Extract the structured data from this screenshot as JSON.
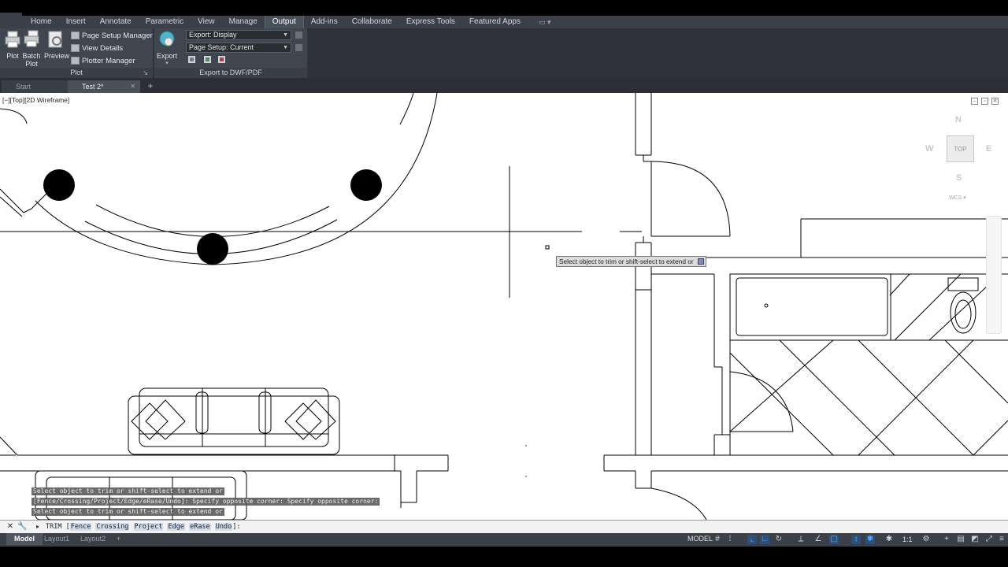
{
  "ribbon": {
    "tabs": [
      {
        "label": "Home"
      },
      {
        "label": "Insert"
      },
      {
        "label": "Annotate"
      },
      {
        "label": "Parametric"
      },
      {
        "label": "View"
      },
      {
        "label": "Manage"
      },
      {
        "label": "Output"
      },
      {
        "label": "Add-ins"
      },
      {
        "label": "Collaborate"
      },
      {
        "label": "Express Tools"
      },
      {
        "label": "Featured Apps"
      }
    ],
    "active_tab": "Output",
    "plot_panel": {
      "title": "Plot",
      "plot_label": "Plot",
      "batch_plot_label": "Batch Plot",
      "preview_label": "Preview",
      "page_setup_manager": "Page Setup Manager",
      "view_details": "View Details",
      "plotter_manager": "Plotter Manager"
    },
    "export_panel": {
      "title": "Export to DWF/PDF",
      "export_label": "Export",
      "export_dropdown": "Export: Display",
      "page_setup_dropdown": "Page Setup: Current"
    }
  },
  "doc_tabs": {
    "start": "Start",
    "current": "Test 2*"
  },
  "viewport": {
    "label": "[−][Top][2D Wireframe]",
    "viewcube": {
      "n": "N",
      "s": "S",
      "e": "E",
      "w": "W",
      "top": "TOP",
      "wcs": "WCS"
    }
  },
  "tooltip": "Select object to trim or shift-select to extend or",
  "command_history": [
    "Select object to trim or shift-select to extend or",
    "[Fence/Crossing/Project/Edge/eRase/Undo]: Specify opposite corner: Specify opposite corner:",
    "Select object to trim or shift-select to extend or"
  ],
  "command_line": {
    "prompt": "TRIM [",
    "options": [
      "Fence",
      "Crossing",
      "Project",
      "Edge",
      "eRase",
      "Undo"
    ],
    "suffix": "]:"
  },
  "status": {
    "layouts": [
      "Model",
      "Layout1",
      "Layout2"
    ],
    "model": "MODEL",
    "scale": "1:1"
  },
  "icons": {
    "close_cmd": "close-icon",
    "customize_cmd": "wrench-icon"
  }
}
